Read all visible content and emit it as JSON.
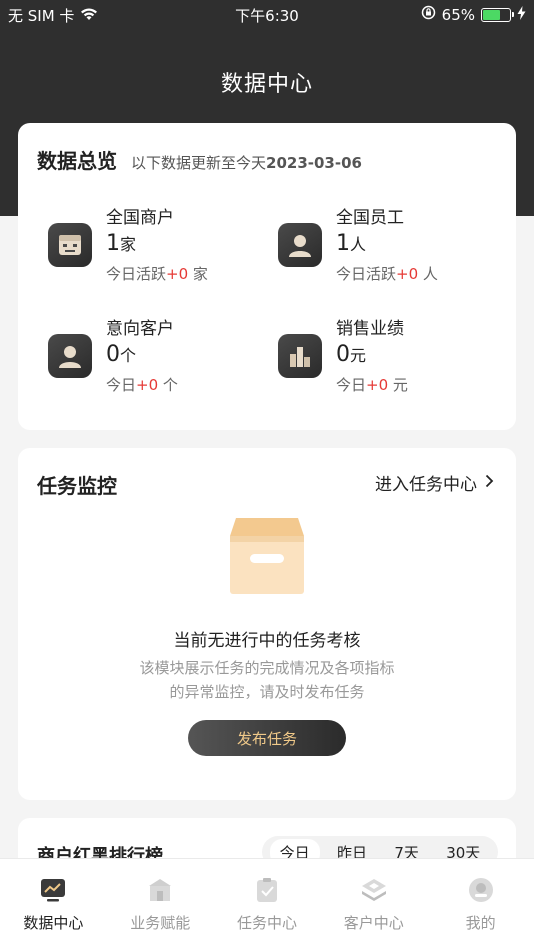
{
  "status": {
    "carrier": "无 SIM 卡",
    "time": "下午6:30",
    "battery": "65%",
    "battery_level": 0.65
  },
  "nav": {
    "title": "数据中心"
  },
  "overview": {
    "title": "数据总览",
    "subtitle_prefix": "以下数据更新至今天",
    "date": "2023-03-06",
    "stats": [
      {
        "name": "全国商户",
        "value": "1",
        "unit": "家",
        "sub_prefix": "今日活跃",
        "sub_value": "+0",
        "sub_unit": " 家",
        "icon": "merchant-icon"
      },
      {
        "name": "全国员工",
        "value": "1",
        "unit": "人",
        "sub_prefix": "今日活跃",
        "sub_value": "+0",
        "sub_unit": " 人",
        "icon": "employee-icon"
      },
      {
        "name": "意向客户",
        "value": "0",
        "unit": "个",
        "sub_prefix": "今日",
        "sub_value": "+0",
        "sub_unit": " 个",
        "icon": "customer-icon"
      },
      {
        "name": "销售业绩",
        "value": "0",
        "unit": "元",
        "sub_prefix": "今日",
        "sub_value": "+0",
        "sub_unit": " 元",
        "icon": "sales-chart-icon"
      }
    ]
  },
  "task": {
    "title": "任务监控",
    "link": "进入任务中心",
    "empty_title": "当前无进行中的任务考核",
    "empty_desc_line1": "该模块展示任务的完成情况及各项指标",
    "empty_desc_line2": "的异常监控，请及时发布任务",
    "publish_label": "发布任务"
  },
  "rank": {
    "title": "商户红黑排行榜",
    "tabs": [
      "今日",
      "昨日",
      "7天",
      "30天"
    ],
    "active_tab": 0
  },
  "tabbar": [
    {
      "label": "数据中心",
      "icon": "data-center-icon",
      "active": true
    },
    {
      "label": "业务赋能",
      "icon": "business-icon",
      "active": false
    },
    {
      "label": "任务中心",
      "icon": "task-icon",
      "active": false
    },
    {
      "label": "客户中心",
      "icon": "customer-center-icon",
      "active": false
    },
    {
      "label": "我的",
      "icon": "profile-icon",
      "active": false
    }
  ],
  "colors": {
    "dark": "#2f2f2f",
    "accent_red": "#e53935",
    "gold": "#f0c989",
    "battery_green": "#4cd964"
  }
}
